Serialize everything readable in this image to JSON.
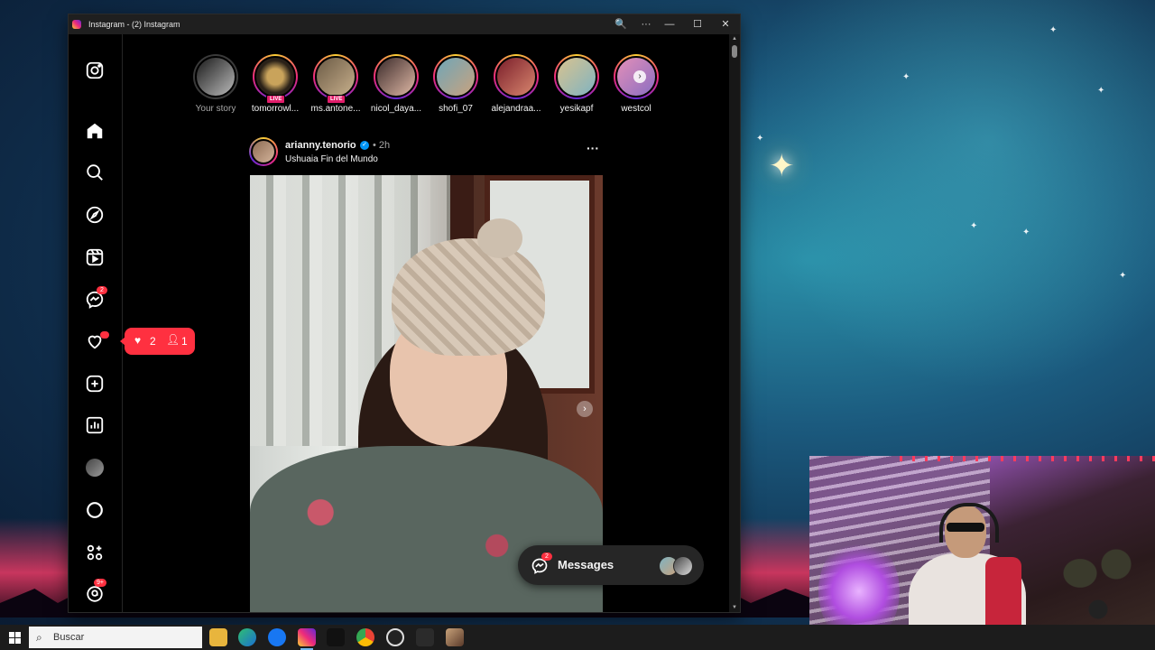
{
  "window": {
    "title": "Instagram - (2) Instagram",
    "controls": {
      "zoom": "🔍",
      "more": "···",
      "minimize": "—",
      "maximize": "☐",
      "close": "✕"
    }
  },
  "sidebar": {
    "items": [
      {
        "name": "instagram-logo-icon"
      },
      {
        "name": "home-icon"
      },
      {
        "name": "search-icon"
      },
      {
        "name": "explore-icon"
      },
      {
        "name": "reels-icon"
      },
      {
        "name": "messenger-icon",
        "badge": "2"
      },
      {
        "name": "notifications-heart-icon"
      },
      {
        "name": "create-icon"
      },
      {
        "name": "dashboard-icon"
      },
      {
        "name": "profile-avatar"
      },
      {
        "name": "threads-icon"
      },
      {
        "name": "more-apps-icon"
      },
      {
        "name": "threads-app-icon",
        "badge": "9+"
      }
    ]
  },
  "notification_pill": {
    "likes": "2",
    "follows": "1"
  },
  "stories": [
    {
      "label": "Your story",
      "live": false,
      "seen": true
    },
    {
      "label": "tomorrowl...",
      "live": true
    },
    {
      "label": "ms.antone...",
      "live": true
    },
    {
      "label": "nicol_daya...",
      "live": false
    },
    {
      "label": "shofi_07",
      "live": false
    },
    {
      "label": "alejandraa...",
      "live": false
    },
    {
      "label": "yesikapf",
      "live": false
    },
    {
      "label": "westcol",
      "live": false
    }
  ],
  "live_label": "LIVE",
  "post": {
    "username": "arianny.tenorio",
    "time": "• 2h",
    "location": "Ushuaia Fin del Mundo",
    "more": "···"
  },
  "messages": {
    "label": "Messages",
    "badge": "2"
  },
  "taskbar": {
    "search_placeholder": "Buscar"
  },
  "colors": {
    "badge_red": "#ff3040",
    "verified_blue": "#0095f6",
    "messages_bg": "#262626"
  }
}
